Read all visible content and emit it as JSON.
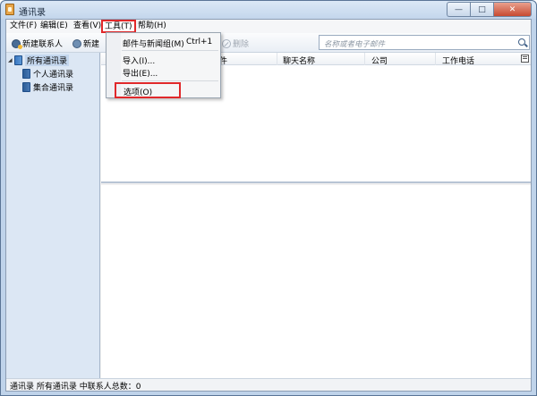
{
  "window": {
    "title": "通讯录",
    "controls": {
      "minimize": "—",
      "maximize": "□",
      "close": "✕"
    }
  },
  "menubar": {
    "file": "文件(F)",
    "edit": "编辑(E)",
    "view": "查看(V)",
    "tools": "工具(T)",
    "help": "帮助(H)"
  },
  "toolbar": {
    "new_contact": "新建联系人",
    "new_group": "新建",
    "delete": "删除"
  },
  "search": {
    "placeholder": "名称或者电子邮件"
  },
  "tree": {
    "items": [
      {
        "label": "所有通讯录",
        "level": 0,
        "selected": true
      },
      {
        "label": "个人通讯录",
        "level": 1,
        "selected": false
      },
      {
        "label": "集合通讯录",
        "level": 1,
        "selected": false
      }
    ]
  },
  "columns": {
    "name_partial": "件",
    "chat_name": "聊天名称",
    "company": "公司",
    "work_phone": "工作电话"
  },
  "tools_menu": {
    "mail_news": "邮件与新闻组(M)",
    "mail_news_shortcut": "Ctrl+1",
    "import": "导入(I)...",
    "export": "导出(E)...",
    "options": "选项(O)"
  },
  "statusbar": {
    "text": "通讯录 所有通讯录 中联系人总数：0"
  },
  "colors": {
    "highlight": "#e0282a",
    "tree_background": "#dce7f4",
    "window_chrome": "#bfd3ea"
  }
}
